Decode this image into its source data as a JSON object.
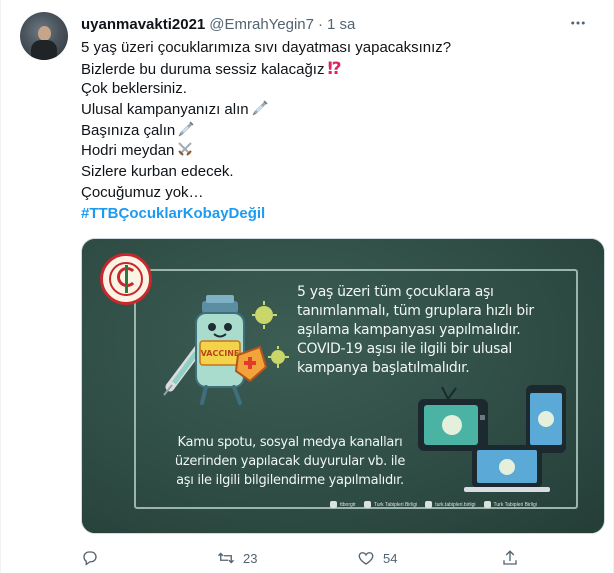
{
  "tweet": {
    "display_name": "uyanmavakti2021",
    "handle": "@EmrahYegin7",
    "separator": "·",
    "time": "1 sa",
    "lines": [
      "5 yaş üzeri çocuklarımıza sıvı dayatması yapacaksınız?",
      "Bizlerde bu duruma sessiz kalacağız",
      "Çok beklersiniz.",
      "Ulusal kampanyanızı alın",
      "Başınıza çalın",
      "Hodri meydan",
      "Sizlere kurban edecek.",
      "Çocuğumuz yok…"
    ],
    "emojis": {
      "line2": "⁉",
      "line4": "syringe-emoji",
      "line5": "syringe-emoji",
      "line6": "crossed-swords-emoji"
    },
    "hashtag": "#TTBÇocuklarKobayDeğil"
  },
  "media": {
    "board_text_1": [
      "5 yaş üzeri tüm çocuklara aşı",
      "tanımlanmalı, tüm gruplara hızlı bir",
      "aşılama kampanyası yapılmalıdır.",
      "COVID-19 aşısı ile ilgili bir ulusal",
      "kampanya başlatılmalıdır."
    ],
    "board_text_2": [
      "Kamu spotu, sosyal medya kanalları",
      "üzerinden yapılacak duyurular vb. ile",
      "aşı ile ilgili bilgilendirme yapılmalıdır."
    ],
    "vaccine_label": "VACCINE",
    "social": [
      "ttborgtr",
      "Turk Tabipleri Birligi",
      "turk.tabipleri.birligi",
      "Turk Tabipleri Birligi"
    ]
  },
  "actions": {
    "reply_count": "",
    "retweet_count": "23",
    "like_count": "54"
  },
  "colors": {
    "accent": "#1d9bf0",
    "text": "#0f1419",
    "secondary": "#536471",
    "board": "#2f4d45"
  }
}
